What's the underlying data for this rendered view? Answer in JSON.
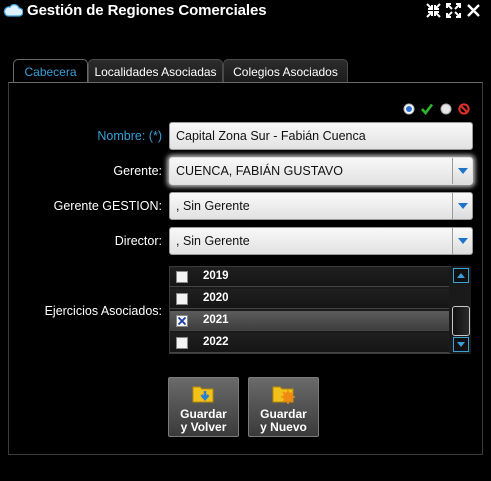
{
  "window": {
    "title": "Gestión de Regiones Comerciales"
  },
  "tabs": [
    {
      "label": "Cabecera",
      "active": true
    },
    {
      "label": "Localidades Asociadas",
      "active": false
    },
    {
      "label": "Colegios Asociados",
      "active": false
    }
  ],
  "form": {
    "nombre_label": "Nombre: (*)",
    "nombre_value": "Capital Zona Sur - Fabián Cuenca",
    "gerente_label": "Gerente:",
    "gerente_value": "CUENCA, FABIÁN GUSTAVO",
    "gerente_gestion_label": "Gerente GESTION:",
    "gerente_gestion_value": ", Sin Gerente",
    "director_label": "Director:",
    "director_value": ", Sin Gerente",
    "ejercicios_label": "Ejercicios Asociados:"
  },
  "ejercicios": [
    {
      "year": "2019",
      "checked": false
    },
    {
      "year": "2020",
      "checked": false
    },
    {
      "year": "2021",
      "checked": true
    },
    {
      "year": "2022",
      "checked": false
    }
  ],
  "buttons": {
    "guardar_volver_line1": "Guardar",
    "guardar_volver_line2": "y Volver",
    "guardar_nuevo_line1": "Guardar",
    "guardar_nuevo_line2": "y Nuevo"
  },
  "colors": {
    "accent": "#3aa0d8",
    "ok": "#2db52d",
    "cancel": "#e0302a"
  },
  "icons": {
    "title": "cloud-icon",
    "minimize": "compress-icon",
    "maximize": "expand-icon",
    "close": "close-icon",
    "status": [
      "radio-blue-icon",
      "check-icon",
      "radio-gray-icon",
      "forbidden-icon"
    ],
    "save_back": "folder-download-icon",
    "save_new": "folder-new-icon"
  }
}
